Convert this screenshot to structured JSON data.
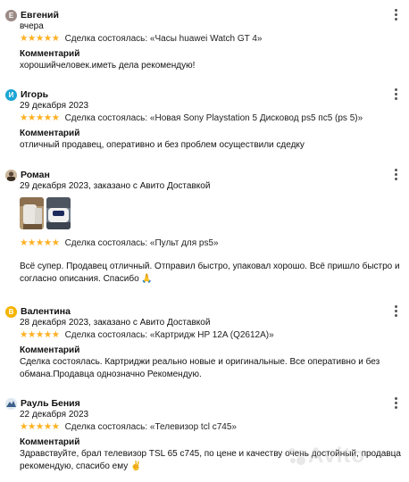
{
  "colors": {
    "star": "#ffb021",
    "avatar_evgeny": "#9b8b86",
    "avatar_igor": "#1ba5d4",
    "avatar_valentina": "#f5b400"
  },
  "reviews": [
    {
      "name": "Евгений",
      "avatar_letter": "Е",
      "date": "вчера",
      "deal": "Сделка состоялась: «Часы huawei Watch GT 4»",
      "comment_label": "Комментарий",
      "comment": "хорошийчеловек.иметь дела рекомендую!"
    },
    {
      "name": "Игорь",
      "avatar_letter": "И",
      "date": "29 декабря 2023",
      "deal": "Сделка состоялась: «Новая Sony Playstation 5 Дисковод ps5 пс5 (ps 5)»",
      "comment_label": "Комментарий",
      "comment": "отличный продавец, оперативно и без проблем осуществили сдедку"
    },
    {
      "name": "Роман",
      "avatar_letter": "",
      "date": "29 декабря 2023, заказано с Авито Доставкой",
      "deal": "Сделка состоялась: «Пульт для ps5»",
      "comment": "Всё супер. Продавец отличный. Отправил быстро, упаковал хорошо. Всё пришло быстро и согласно описания. Спасибо 🙏"
    },
    {
      "name": "Валентина",
      "avatar_letter": "В",
      "date": "28 декабря 2023, заказано с Авито Доставкой",
      "deal": "Сделка состоялась: «Картридж HP 12A (Q2612A)»",
      "comment_label": "Комментарий",
      "comment": "Сделка состоялась. Картриджи реально новые и оригинальные. Все оперативно и без обмана.Продавца однозначно Рекомендую."
    },
    {
      "name": "Рауль Бения",
      "avatar_letter": "",
      "date": "22 декабря 2023",
      "deal": "Сделка состоялась: «Телевизор tcl c745»",
      "comment_label": "Комментарий",
      "comment": "Здравствуйте, брал телевизор TSL 65 c745, по цене и качеству очень достойный, продавца рекомендую, спасибо ему ✌️"
    }
  ],
  "stars": "★★★★★",
  "watermark": "Avito"
}
